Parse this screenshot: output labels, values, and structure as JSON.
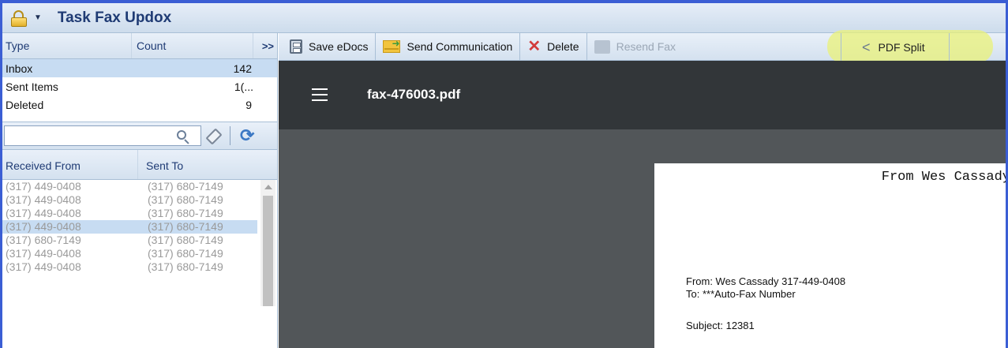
{
  "window": {
    "title": "Task Fax Updox"
  },
  "left_panel": {
    "columns": {
      "type": "Type",
      "count": "Count",
      "collapse": ">>"
    },
    "folders": [
      {
        "name": "Inbox",
        "count": "142",
        "selected": true
      },
      {
        "name": "Sent Items",
        "count": "1(...",
        "selected": false
      },
      {
        "name": "Deleted",
        "count": "9",
        "selected": false
      }
    ],
    "search": {
      "value": "",
      "placeholder": ""
    },
    "list_headers": {
      "received_from": "Received From",
      "sent_to": "Sent To"
    },
    "rows": [
      {
        "from": "(317) 449-0408",
        "to": "(317) 680-7149",
        "selected": false
      },
      {
        "from": "(317) 449-0408",
        "to": "(317) 680-7149",
        "selected": false
      },
      {
        "from": "(317) 449-0408",
        "to": "(317) 680-7149",
        "selected": false
      },
      {
        "from": "(317) 449-0408",
        "to": "(317) 680-7149",
        "selected": true
      },
      {
        "from": "(317) 680-7149",
        "to": "(317) 680-7149",
        "selected": false
      },
      {
        "from": "(317) 449-0408",
        "to": "(317) 680-7149",
        "selected": false
      },
      {
        "from": "(317) 449-0408",
        "to": "(317) 680-7149",
        "selected": false
      }
    ]
  },
  "toolbar": {
    "save_edocs": "Save eDocs",
    "send_communication": "Send Communication",
    "delete": "Delete",
    "resend_fax": "Resend Fax",
    "pdf_split": "PDF Split"
  },
  "viewer": {
    "filename": "fax-476003.pdf",
    "page_header": "From Wes Cassady",
    "from_line": "From: Wes Cassady  317-449-0408",
    "to_line": "To: ***Auto-Fax Number",
    "subject_line": "Subject: 12381"
  },
  "colors": {
    "accent": "#3b5ed4",
    "selection": "#c7dcf2",
    "highlight": "#eaf278",
    "viewer_bar": "#323639"
  }
}
